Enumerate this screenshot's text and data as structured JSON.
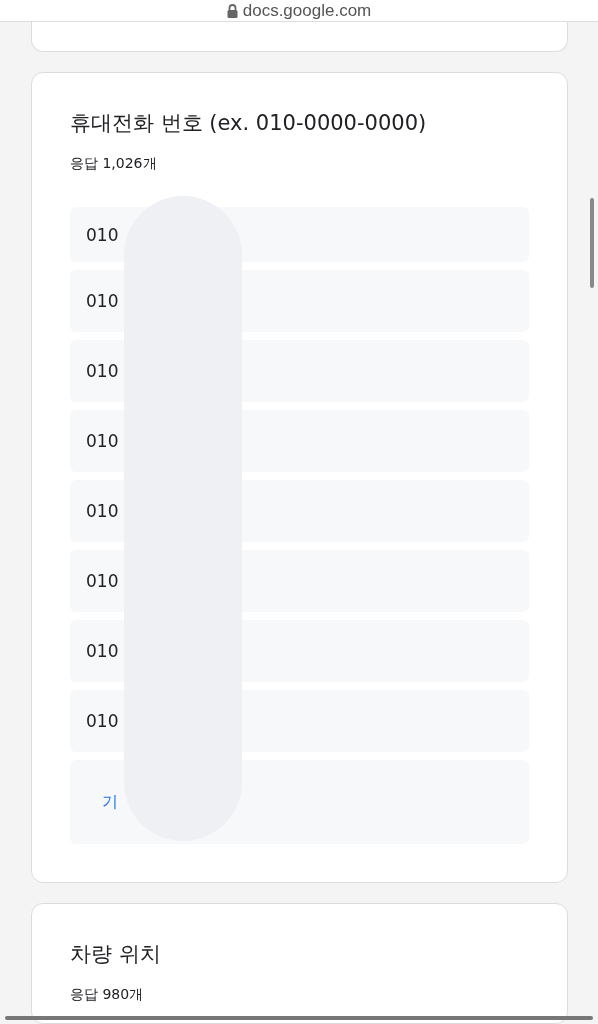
{
  "address_bar": {
    "url": "docs.google.com"
  },
  "questions": [
    {
      "title": "휴대전화 번호 (ex. 010-0000-0000)",
      "count": "응답 1,026개",
      "answers": [
        {
          "text": "010"
        },
        {
          "text": "010"
        },
        {
          "text": "010"
        },
        {
          "text": "010"
        },
        {
          "text": "010"
        },
        {
          "text": "010"
        },
        {
          "text": "010"
        },
        {
          "text": "010"
        }
      ],
      "more_link": "기"
    },
    {
      "title": "차량 위치",
      "count": "응답 980개"
    }
  ]
}
